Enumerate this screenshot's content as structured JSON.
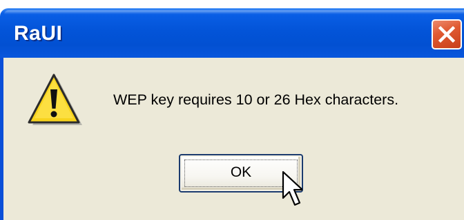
{
  "window": {
    "title": "RaUI",
    "close_icon": "close-icon",
    "colors": {
      "titlebar": "#0354d8",
      "close_button": "#e05a32",
      "client_background": "#ece9d8"
    }
  },
  "dialog": {
    "icon": "warning-icon",
    "message": "WEP key requires 10 or 26 Hex characters.",
    "ok_label": "OK"
  },
  "pointer": {
    "icon": "mouse-cursor-icon"
  }
}
